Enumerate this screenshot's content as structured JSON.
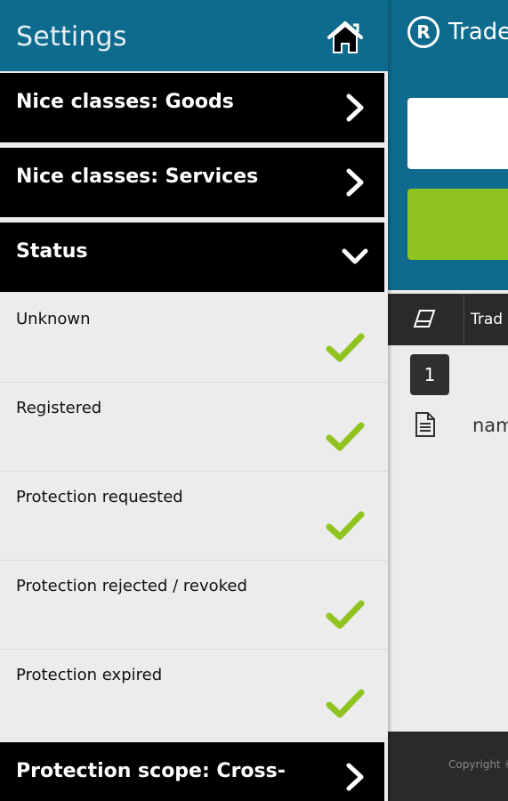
{
  "main": {
    "app_title": "Trade",
    "table_header_label": "Trad",
    "page_number": "1",
    "row_text": "nam",
    "copyright": "Copyright ©"
  },
  "drawer": {
    "title": "Settings",
    "sections": [
      {
        "label": "Nice classes: Goods",
        "state": "collapsed"
      },
      {
        "label": "Nice classes: Services",
        "state": "collapsed"
      },
      {
        "label": "Status",
        "state": "expanded"
      },
      {
        "label": "Protection scope: Cross-",
        "state": "collapsed"
      }
    ],
    "status_options": [
      {
        "label": "Unknown",
        "checked": true
      },
      {
        "label": "Registered",
        "checked": true
      },
      {
        "label": "Protection requested",
        "checked": true
      },
      {
        "label": "Protection rejected / revoked",
        "checked": true
      },
      {
        "label": "Protection expired",
        "checked": true
      }
    ]
  },
  "colors": {
    "header_blue": "#0f6b8d",
    "accent_green": "#8fc31f",
    "section_black": "#000000"
  }
}
